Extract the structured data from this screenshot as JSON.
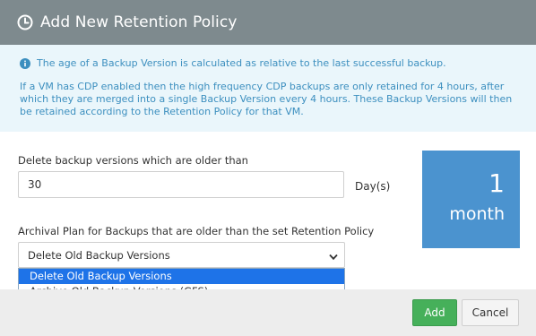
{
  "dialog": {
    "title": "Add New Retention Policy"
  },
  "info": {
    "line1": "The age of a Backup Version is calculated as relative to the last successful backup.",
    "paragraph": "If a VM has CDP enabled then the high frequency CDP backups are only retained for 4 hours, after which they are merged into a single Backup Version every 4 hours. These Backup Versions will then be retained according to the Retention Policy for that VM."
  },
  "retention": {
    "label": "Delete backup versions which are older than",
    "value": "30",
    "unit": "Day(s)"
  },
  "summary": {
    "number": "1",
    "unit": "month"
  },
  "archival": {
    "label": "Archival Plan for Backups that are older than the set Retention Policy",
    "selected": "Delete Old Backup Versions",
    "options": [
      "Delete Old Backup Versions",
      "Archive Old Backup Versions (GFS)"
    ]
  },
  "footer": {
    "add_label": "Add",
    "cancel_label": "Cancel"
  },
  "colors": {
    "header_bg": "#7e8a8e",
    "info_text": "#3c8fbf",
    "tile_bg": "#4b93cf",
    "add_button": "#46b05a",
    "dropdown_highlight": "#1e73e8"
  }
}
